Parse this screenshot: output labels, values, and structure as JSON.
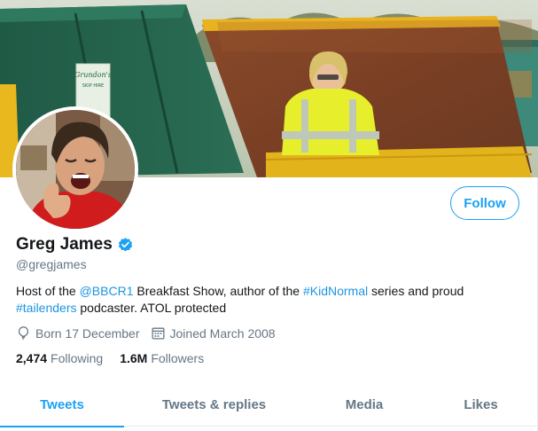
{
  "profile": {
    "display_name": "Greg James",
    "handle": "@gregjames",
    "verified": true,
    "follow_label": "Follow",
    "bio": {
      "t1": "Host of the ",
      "mention": "@BBCR1",
      "t2": " Breakfast Show, author of the ",
      "hashtag1": "#KidNormal",
      "t3": " series and proud ",
      "hashtag2": "#tailenders",
      "t4": " podcaster. ATOL protected"
    },
    "birthday": "Born 17 December",
    "joined": "Joined March 2008",
    "following_count": "2,474",
    "following_label": "Following",
    "followers_count": "1.6M",
    "followers_label": "Followers"
  },
  "tabs": [
    {
      "label": "Tweets",
      "active": true
    },
    {
      "label": "Tweets & replies",
      "active": false
    },
    {
      "label": "Media",
      "active": false
    },
    {
      "label": "Likes",
      "active": false
    }
  ],
  "banner_sign": {
    "line1": "Grundon's",
    "line2": "SKIP HIRE"
  },
  "colors": {
    "accent": "#1da1f2",
    "link": "#1b95e0",
    "muted_text": "#657786",
    "text": "#14171a",
    "divider": "#e6ecf0"
  },
  "icons": {
    "verified": "verified-badge-icon",
    "birthday": "balloon-icon",
    "joined": "calendar-icon"
  }
}
